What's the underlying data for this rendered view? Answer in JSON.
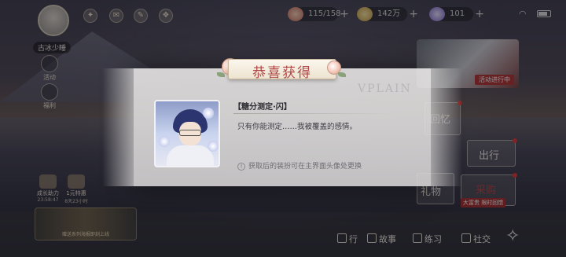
{
  "header": {
    "player_name": "古冰少睡",
    "resources": [
      {
        "icon": "cake-icon",
        "value": "115/158"
      },
      {
        "icon": "gold-ingot-icon",
        "value": "142万"
      },
      {
        "icon": "gem-icon",
        "value": "101"
      }
    ],
    "plus": "+"
  },
  "left_menu": {
    "items": [
      {
        "label": "活动"
      },
      {
        "label": "福利"
      }
    ],
    "promos": [
      {
        "title": "成长助力",
        "sub": "23:58:47"
      },
      {
        "title": "1元特惠",
        "sub": "8天23小时"
      }
    ],
    "banner_caption": "赠送系列海报即刻上线"
  },
  "right_panel": {
    "event_tag": "活动进行中",
    "tiles": [
      {
        "label": "回忆"
      },
      {
        "label": "出行"
      },
      {
        "label": "礼物"
      },
      {
        "label": "采购"
      }
    ],
    "shop_tag": "大富贵 限时回馈"
  },
  "bottom_bar": {
    "items": [
      {
        "label": "行"
      },
      {
        "label": "故事"
      },
      {
        "label": "练习"
      },
      {
        "label": "社交"
      }
    ]
  },
  "modal": {
    "title": "恭喜获得",
    "watermark": "VPLAIN",
    "item_name": "【糖分测定·闪】",
    "description": "只有你能测定……我被覆盖的感情。",
    "hint_icon": "!",
    "hint": "获取后的装扮可在主界面头像处更换"
  },
  "colors": {
    "title": "#b04848",
    "alert_red": "#d33333"
  }
}
